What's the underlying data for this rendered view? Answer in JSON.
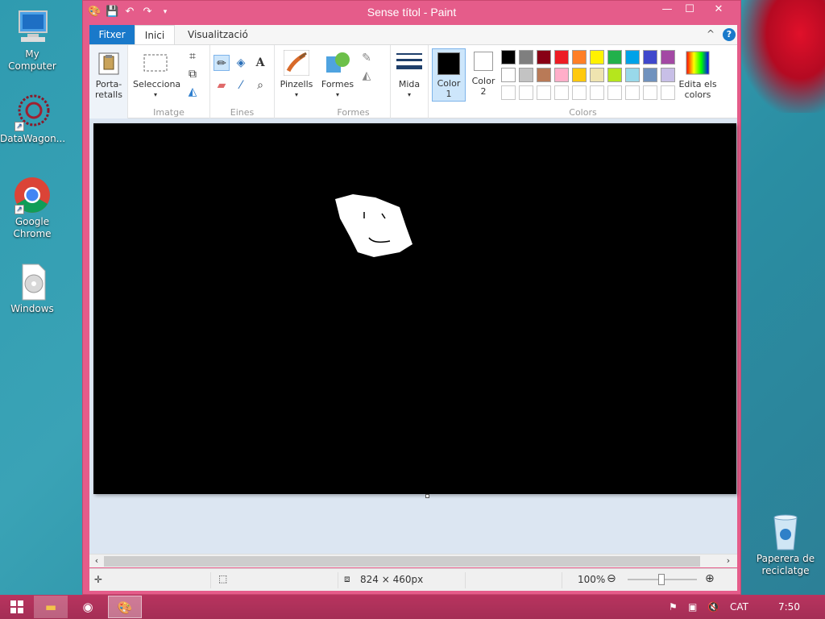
{
  "desktop": {
    "icons": [
      {
        "label": "My Computer"
      },
      {
        "label": "DataWagon..."
      },
      {
        "label": "Google Chrome"
      },
      {
        "label": "Windows"
      },
      {
        "label": "Paperera de reciclatge"
      }
    ]
  },
  "window": {
    "title": "Sense títol - Paint",
    "minimize": "—",
    "maximize": "☐",
    "close": "✕"
  },
  "ribbon": {
    "tabs": [
      {
        "label": "Fitxer"
      },
      {
        "label": "Inici"
      },
      {
        "label": "Visualització"
      }
    ],
    "collapse": "^",
    "help": "?",
    "clipboard": {
      "label": "Porta-\nretalls",
      "group": ""
    },
    "image": {
      "select": "Selecciona",
      "group": "Imatge"
    },
    "tools": {
      "group": "Eines"
    },
    "brushes": {
      "label": "Pinzells"
    },
    "shapes": {
      "label": "Formes",
      "group": "Formes"
    },
    "size": {
      "label": "Mida"
    },
    "color1": {
      "label": "Color\n1",
      "value": "#000000"
    },
    "color2": {
      "label": "Color\n2",
      "value": "#ffffff"
    },
    "colors_group": "Colors",
    "edit_colors": "Edita els colors",
    "palette_row1": [
      "#000000",
      "#7f7f7f",
      "#880015",
      "#ed1c24",
      "#ff7f27",
      "#fff200",
      "#22b14c",
      "#00a2e8",
      "#3f48cc",
      "#a349a4"
    ],
    "palette_row2": [
      "#ffffff",
      "#c3c3c3",
      "#b97a57",
      "#ffaec9",
      "#ffc90e",
      "#efe4b0",
      "#b5e61d",
      "#99d9ea",
      "#7092be",
      "#c8bfe7"
    ]
  },
  "status": {
    "size": "824 × 460px",
    "zoom": "100%"
  },
  "taskbar": {
    "lang": "CAT",
    "time": "7:50"
  }
}
